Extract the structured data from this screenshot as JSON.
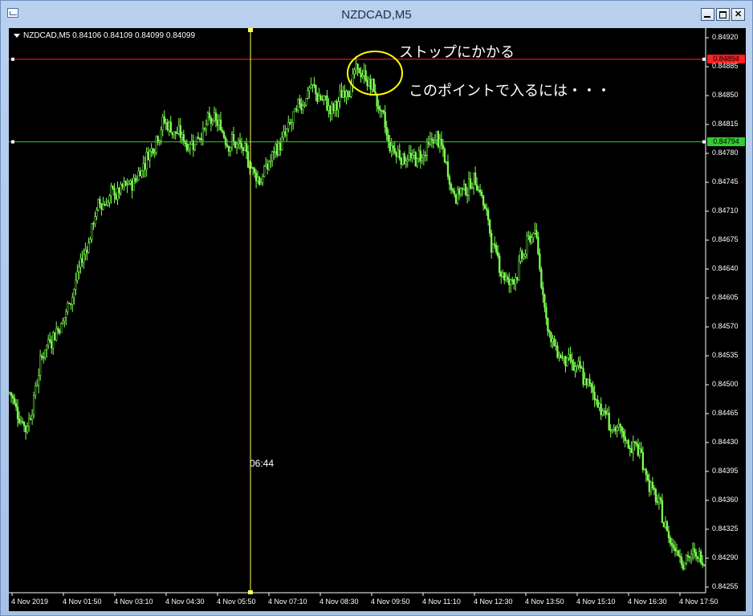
{
  "window": {
    "title": "NZDCAD,M5",
    "icon": "chart-window-icon",
    "buttons": [
      "minimize",
      "maximize",
      "close"
    ]
  },
  "chart": {
    "symbol_info": "NZDCAD,M5  0.84106 0.84109 0.84099 0.84099",
    "crosshair_time": "06:44",
    "annotations": {
      "stop": "ストップにかかる",
      "entry": "このポイントで入るには・・・"
    },
    "stop_line_label": "0.84894",
    "entry_line_label": "0.84794",
    "colors": {
      "background": "#000000",
      "candles": "#7dff52",
      "stop_line": "#ff2020",
      "entry_line": "#33cc33",
      "crosshair": "#ffff55",
      "highlight_circle": "#ffff00"
    }
  },
  "chart_data": {
    "type": "candlestick",
    "y_ticks": [
      "0.84920",
      "0.84885",
      "0.84850",
      "0.84815",
      "0.84780",
      "0.84745",
      "0.84710",
      "0.84675",
      "0.84640",
      "0.84605",
      "0.84570",
      "0.84535",
      "0.84500",
      "0.84465",
      "0.84430",
      "0.84395",
      "0.84360",
      "0.84325",
      "0.84290",
      "0.84255"
    ],
    "x_ticks": [
      "4 Nov 2019",
      "4 Nov 01:50",
      "4 Nov 03:10",
      "4 Nov 04:30",
      "4 Nov 05:50",
      "4 Nov 07:10",
      "4 Nov 08:30",
      "4 Nov 09:50",
      "4 Nov 11:10",
      "4 Nov 12:30",
      "4 Nov 13:50",
      "4 Nov 15:10",
      "4 Nov 16:30",
      "4 Nov 17:50"
    ],
    "ylim": [
      0.8425,
      0.8494
    ],
    "horizontal_lines": [
      0.84894,
      0.84794
    ],
    "key_points": [
      {
        "t": 0,
        "price": 0.8449
      },
      {
        "t": 10,
        "price": 0.84445
      },
      {
        "t": 20,
        "price": 0.8454
      },
      {
        "t": 35,
        "price": 0.8459
      },
      {
        "t": 55,
        "price": 0.8472
      },
      {
        "t": 75,
        "price": 0.8474
      },
      {
        "t": 95,
        "price": 0.8482
      },
      {
        "t": 110,
        "price": 0.8479
      },
      {
        "t": 125,
        "price": 0.8482
      },
      {
        "t": 140,
        "price": 0.8479
      },
      {
        "t": 155,
        "price": 0.8475
      },
      {
        "t": 170,
        "price": 0.848
      },
      {
        "t": 185,
        "price": 0.8486
      },
      {
        "t": 200,
        "price": 0.8483
      },
      {
        "t": 215,
        "price": 0.8488
      },
      {
        "t": 225,
        "price": 0.8486
      },
      {
        "t": 235,
        "price": 0.8479
      },
      {
        "t": 250,
        "price": 0.8477
      },
      {
        "t": 265,
        "price": 0.848
      },
      {
        "t": 275,
        "price": 0.8473
      },
      {
        "t": 290,
        "price": 0.8475
      },
      {
        "t": 300,
        "price": 0.8466
      },
      {
        "t": 310,
        "price": 0.8462
      },
      {
        "t": 325,
        "price": 0.8469
      },
      {
        "t": 335,
        "price": 0.8455
      },
      {
        "t": 350,
        "price": 0.8452
      },
      {
        "t": 365,
        "price": 0.8448
      },
      {
        "t": 375,
        "price": 0.8444
      },
      {
        "t": 390,
        "price": 0.8442
      },
      {
        "t": 400,
        "price": 0.8436
      },
      {
        "t": 410,
        "price": 0.8431
      },
      {
        "t": 420,
        "price": 0.8429
      }
    ]
  }
}
